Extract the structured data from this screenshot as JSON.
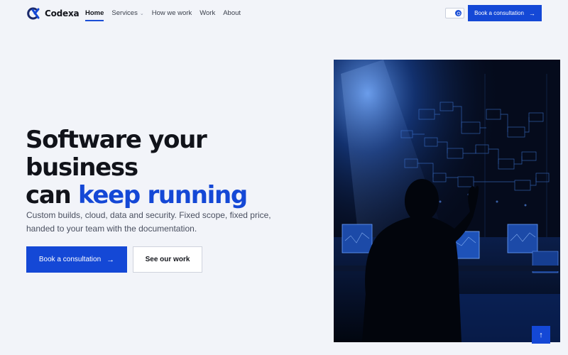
{
  "brand": {
    "name": "Codexa",
    "logo_icon": "codexa-logo-icon"
  },
  "nav": {
    "links": [
      {
        "label": "Home",
        "active": true
      },
      {
        "label": "Services",
        "has_dropdown": true
      },
      {
        "label": "How we work"
      },
      {
        "label": "Work"
      },
      {
        "label": "About"
      }
    ],
    "theme_toggle_icon": "theme-toggle-icon",
    "cta_label": "Book a consultation",
    "cta_icon": "arrow-right-icon"
  },
  "hero": {
    "headline_line1": "Software your business",
    "headline_line2_plain": "can ",
    "headline_line2_accent": "keep running",
    "subtext": "Custom builds, cloud, data and security. Fixed scope, fixed price, handed to your team with the documentation.",
    "primary_button": "Book a consultation",
    "secondary_button": "See our work",
    "image_icon": "hero-photo-person-at-data-wall"
  },
  "scroll_top_icon": "arrow-up-icon",
  "colors": {
    "accent": "#1448d6",
    "background": "#f2f4f9",
    "text": "#11131a"
  }
}
